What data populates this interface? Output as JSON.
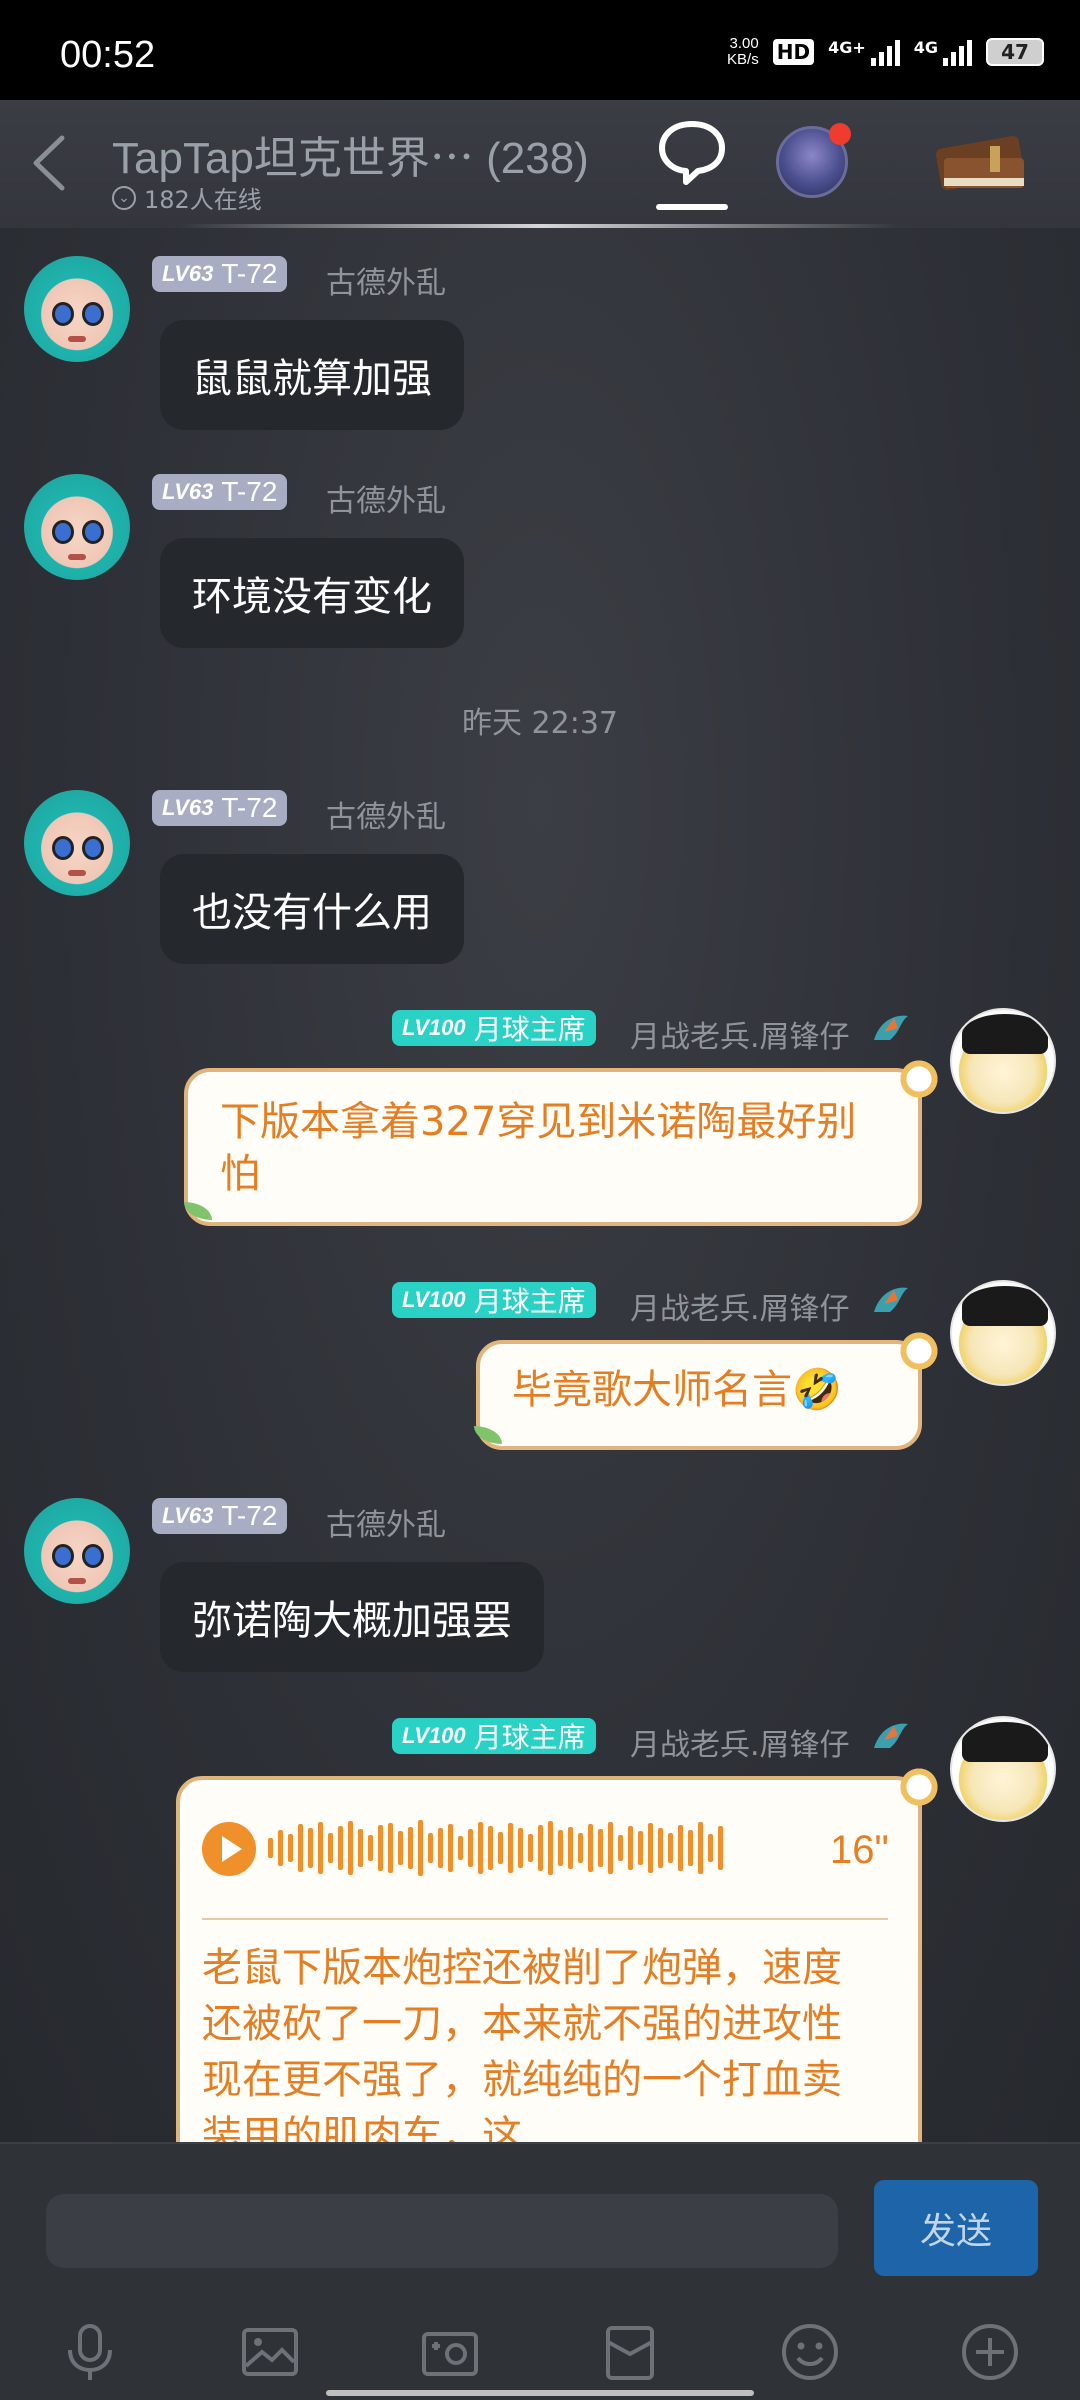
{
  "status_bar": {
    "time": "00:52",
    "net_speed_value": "3.00",
    "net_speed_unit": "KB/s",
    "hd": "HD",
    "sim1_label": "4G+",
    "sim2_label": "4G",
    "battery": "47"
  },
  "header": {
    "title": "TapTap坦克世界⋯ (238)",
    "online": "182人在线"
  },
  "messages": [
    {
      "level": "LV63",
      "badge": "T-72",
      "username": "古德外乱",
      "text": "鼠鼠就算加强"
    },
    {
      "level": "LV63",
      "badge": "T-72",
      "username": "古德外乱",
      "text": "环境没有变化"
    },
    {
      "timestamp": "昨天  22:37"
    },
    {
      "level": "LV63",
      "badge": "T-72",
      "username": "古德外乱",
      "text": "也没有什么用"
    },
    {
      "level": "LV100",
      "badge": "月球主席",
      "username": "月战老兵.屑锋仔",
      "text": "下版本拿着327穿见到米诺陶最好别怕"
    },
    {
      "level": "LV100",
      "badge": "月球主席",
      "username": "月战老兵.屑锋仔",
      "text": "毕竟歌大师名言🤣"
    },
    {
      "level": "LV63",
      "badge": "T-72",
      "username": "古德外乱",
      "text": "弥诺陶大概加强罢"
    },
    {
      "level": "LV100",
      "badge": "月球主席",
      "username": "月战老兵.屑锋仔",
      "voice_duration": "16\"",
      "text": "老鼠下版本炮控还被削了炮弹，速度还被砍了一刀，本来就不强的进攻性现在更不强了，就纯纯的一个打血卖装甲的肌肉车，这"
    }
  ],
  "input": {
    "placeholder": "",
    "send_label": "发送"
  },
  "toolbar_icons": [
    "microphone-icon",
    "image-icon",
    "camera-icon",
    "sticker-icon",
    "emoji-icon",
    "plus-icon"
  ],
  "colors": {
    "accent_send": "#1d64a8",
    "orange_text": "#e57d22",
    "badge_teal": "#2ad2c5",
    "badge_gray": "#a9adc4"
  }
}
